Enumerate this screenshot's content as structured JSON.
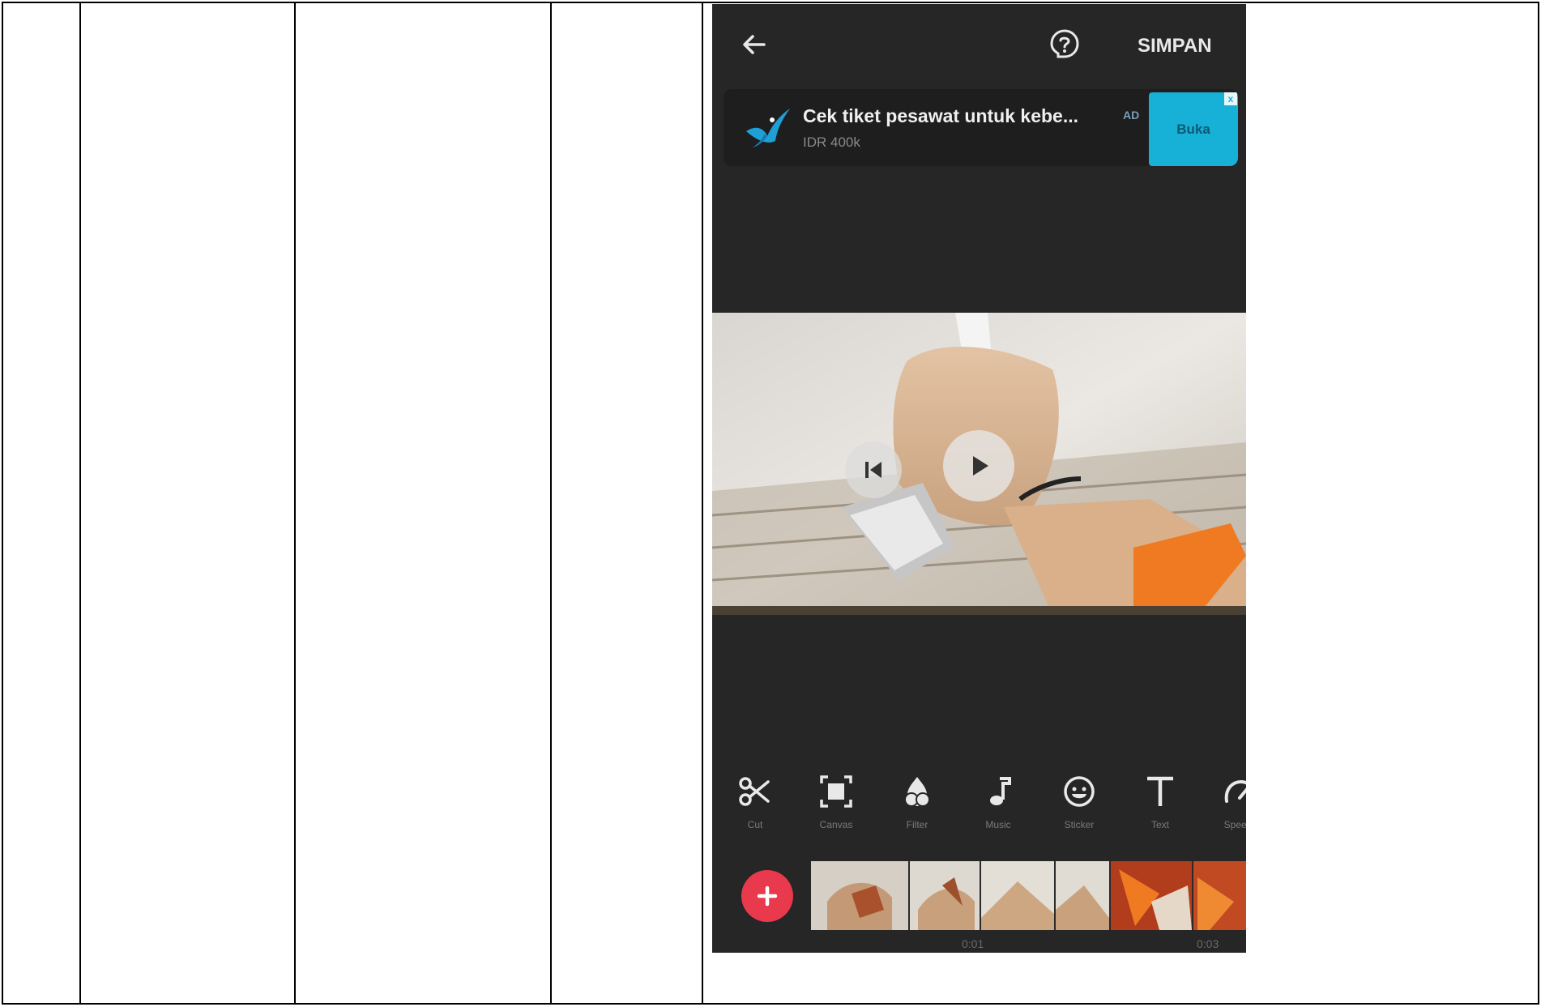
{
  "app": {
    "save_label": "SIMPAN"
  },
  "ad": {
    "title": "Cek tiket pesawat untuk kebe...",
    "subtitle": "IDR 400k",
    "badge": "AD",
    "button_label": "Buka",
    "close_glyph": "x"
  },
  "tools": [
    {
      "label": "Cut",
      "icon": "scissors-icon"
    },
    {
      "label": "Canvas",
      "icon": "crop-frame-icon"
    },
    {
      "label": "Filter",
      "icon": "filter-drop-icon"
    },
    {
      "label": "Music",
      "icon": "music-note-icon"
    },
    {
      "label": "Sticker",
      "icon": "emoji-icon"
    },
    {
      "label": "Text",
      "icon": "text-icon"
    },
    {
      "label": "Speed",
      "icon": "speed-icon"
    }
  ],
  "timeline": {
    "tick_1": "0:01",
    "tick_2": "0:03"
  },
  "colors": {
    "background": "#262626",
    "accent_add": "#e8394d",
    "ad_button": "#17b0d6"
  }
}
